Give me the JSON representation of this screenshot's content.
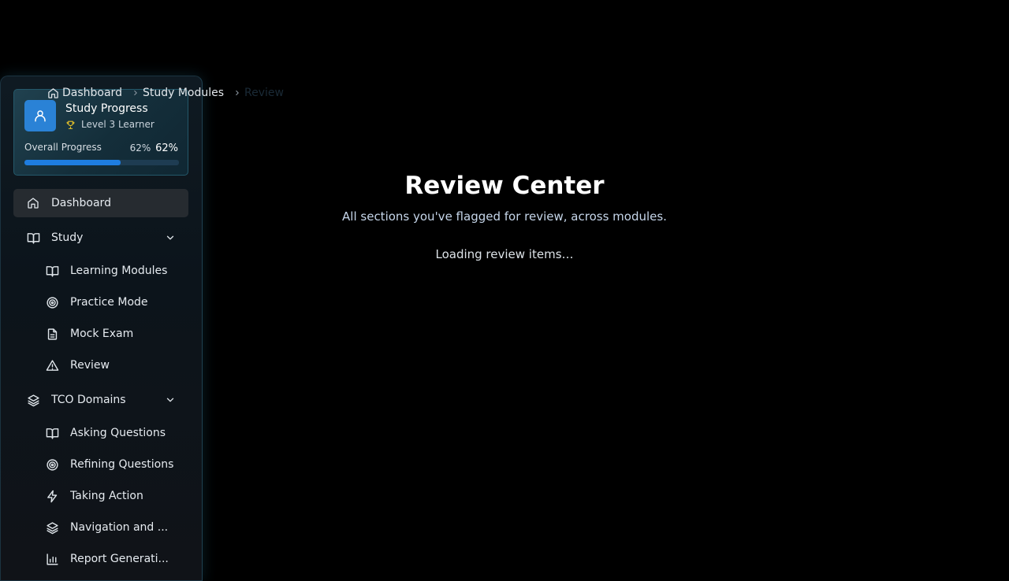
{
  "breadcrumb": {
    "items": [
      "Dashboard",
      "Study Modules",
      "Review"
    ]
  },
  "progress_card": {
    "title": "Study Progress",
    "level": "Level 3 Learner",
    "overall_label": "Overall Progress",
    "percent_small": "62%",
    "percent_large": "62%",
    "progress_fraction": 0.62,
    "accent_color": "#1e7de0",
    "avatar_color": "#2a82d6",
    "trophy_color": "#e6c229"
  },
  "sidebar": {
    "dashboard": "Dashboard",
    "study_group": "Study",
    "study_items": [
      "Learning Modules",
      "Practice Mode",
      "Mock Exam",
      "Review"
    ],
    "tco_group": "TCO Domains",
    "tco_items": [
      "Asking Questions",
      "Refining Questions",
      "Taking Action",
      "Navigation and ...",
      "Report Generati..."
    ]
  },
  "icons": {
    "home": "home-icon",
    "book": "book-open-icon",
    "target": "target-icon",
    "document": "file-text-icon",
    "alert": "alert-triangle-icon",
    "layers": "layers-icon",
    "zap": "zap-icon",
    "chart": "bar-chart-icon",
    "chevron": "chevron-down-icon",
    "user": "user-icon",
    "trophy": "trophy-icon"
  },
  "main": {
    "title": "Review Center",
    "subtitle": "All sections you've flagged for review, across modules.",
    "loading": "Loading review items…"
  }
}
